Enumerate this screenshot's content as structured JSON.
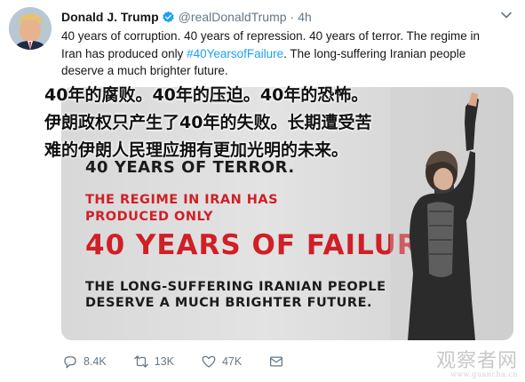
{
  "tweet": {
    "display_name": "Donald J. Trump",
    "handle": "@realDonaldTrump",
    "separator": "·",
    "time": "4h",
    "text_before": "40 years of corruption. 40 years of repression. 40 years of terror. The regime in Iran has produced only ",
    "hashtag": "#40YearsofFailure",
    "text_after": ". The long-suffering Iranian people deserve a much brighter future."
  },
  "poster": {
    "line_terror": "40 YEARS OF TERROR.",
    "line_regime_1": "THE REGIME IN IRAN HAS",
    "line_regime_2": "PRODUCED ONLY",
    "line_failure": "40 YEARS OF FAILURE.",
    "line_people_1": "THE LONG-SUFFERING IRANIAN PEOPLE",
    "line_people_2": "DESERVE A MUCH BRIGHTER FUTURE."
  },
  "translation": {
    "line_1": "40年的腐败。40年的压迫。40年的恐怖。",
    "line_2": "伊朗政权只产生了40年的失败。长期遭受苦",
    "line_3": "难的伊朗人民理应拥有更加光明的未来。"
  },
  "actions": {
    "replies": "8.4K",
    "retweets": "13K",
    "likes": "47K"
  },
  "watermark": {
    "name": "观察者网",
    "url": "www.guancha.cn"
  },
  "colors": {
    "link": "#1da1f2",
    "verified": "#1da1f2",
    "muted": "#657786",
    "poster_red": "#d01f26"
  },
  "icons": {
    "verified": "verified-badge-icon",
    "menu": "chevron-down-icon",
    "reply": "reply-icon",
    "retweet": "retweet-icon",
    "like": "heart-icon",
    "dm": "envelope-icon"
  }
}
